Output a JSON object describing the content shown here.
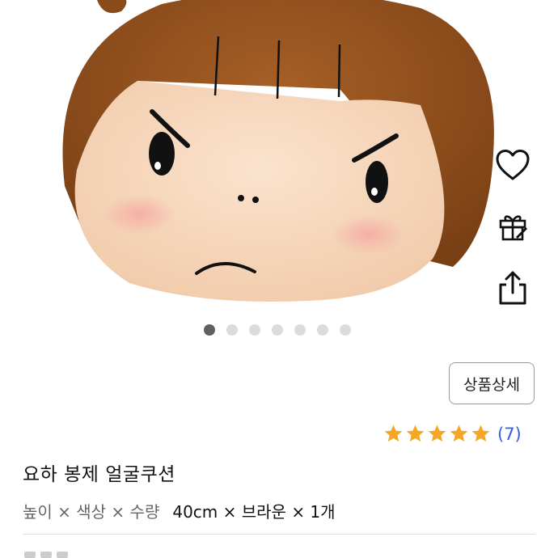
{
  "gallery": {
    "image_alt": "요하 봉제 얼굴쿠션 상품 이미지",
    "dot_count": 7,
    "active_index": 0
  },
  "actions": {
    "wishlist_icon": "heart-icon",
    "gift_icon": "gift-icon",
    "share_icon": "share-icon"
  },
  "detail_button_label": "상품상세",
  "rating": {
    "stars": 5,
    "count_label": "(7)",
    "star_color": "#f5a623"
  },
  "product": {
    "title": "요하 봉제 얼굴쿠션"
  },
  "options": {
    "labels": "높이 × 색상 × 수량",
    "values": "40cm × 브라운 × 1개"
  },
  "colors": {
    "accent": "#2f5fe8",
    "dot_active": "#606060",
    "dot_inactive": "#dcdcdc"
  }
}
